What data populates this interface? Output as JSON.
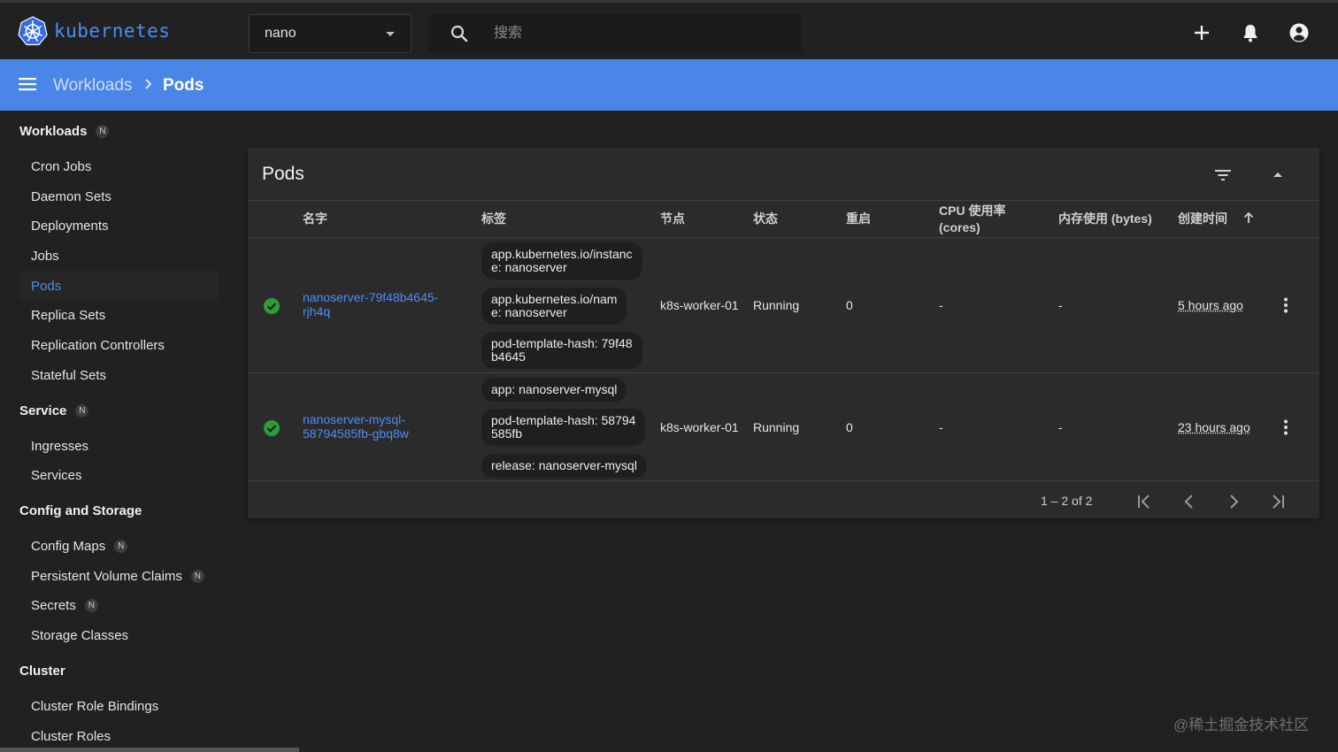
{
  "app": {
    "logo_text": "kubernetes"
  },
  "namespace": {
    "value": "nano"
  },
  "search": {
    "placeholder": "搜索"
  },
  "breadcrumb": {
    "parent": "Workloads",
    "current": "Pods"
  },
  "sidebar": {
    "badge": "N",
    "groups": [
      {
        "label": "Workloads",
        "badge": true,
        "items": [
          "Cron Jobs",
          "Daemon Sets",
          "Deployments",
          "Jobs",
          "Pods",
          "Replica Sets",
          "Replication Controllers",
          "Stateful Sets"
        ]
      },
      {
        "label": "Service",
        "badge": true,
        "items": [
          "Ingresses",
          "Services"
        ]
      },
      {
        "label": "Config and Storage",
        "badge": false,
        "items": [
          "Config Maps",
          "Persistent Volume Claims",
          "Secrets",
          "Storage Classes"
        ]
      },
      {
        "label": "Cluster",
        "badge": false,
        "items": [
          "Cluster Role Bindings",
          "Cluster Roles"
        ]
      }
    ],
    "active_item": "Pods"
  },
  "card": {
    "title": "Pods",
    "columns": {
      "name": "名字",
      "labels": "标签",
      "node": "节点",
      "status": "状态",
      "restarts": "重启",
      "cpu_line1": "CPU 使用率",
      "cpu_line2": "(cores)",
      "memory": "内存使用 (bytes)",
      "created": "创建时间"
    },
    "rows": [
      {
        "name_line1": "nanoserver-79f48b4645-",
        "name_line2": "rjh4q",
        "labels": [
          {
            "line1": "app.kubernetes.io/instanc",
            "line2": "e: nanoserver"
          },
          {
            "line1": "app.kubernetes.io/nam",
            "line2": "e: nanoserver"
          },
          {
            "line1": "pod-template-hash: 79f48",
            "line2": "b4645"
          }
        ],
        "node": "k8s-worker-01",
        "status": "Running",
        "restarts": "0",
        "cpu": "-",
        "memory": "-",
        "age": "5 hours ago"
      },
      {
        "name_line1": "nanoserver-mysql-",
        "name_line2": "58794585fb-gbq8w",
        "labels": [
          {
            "line1": "app: nanoserver-mysql",
            "line2": ""
          },
          {
            "line1": "pod-template-hash: 58794",
            "line2": "585fb"
          },
          {
            "line1": "release: nanoserver-mysql",
            "line2": ""
          }
        ],
        "node": "k8s-worker-01",
        "status": "Running",
        "restarts": "0",
        "cpu": "-",
        "memory": "-",
        "age": "23 hours ago"
      }
    ],
    "pagination": {
      "range": "1 – 2 of 2"
    }
  },
  "watermark": "@稀土掘金技术社区",
  "colors": {
    "accent": "#4a86e8",
    "link": "#4e8cf5",
    "success": "#2e9c3a"
  }
}
